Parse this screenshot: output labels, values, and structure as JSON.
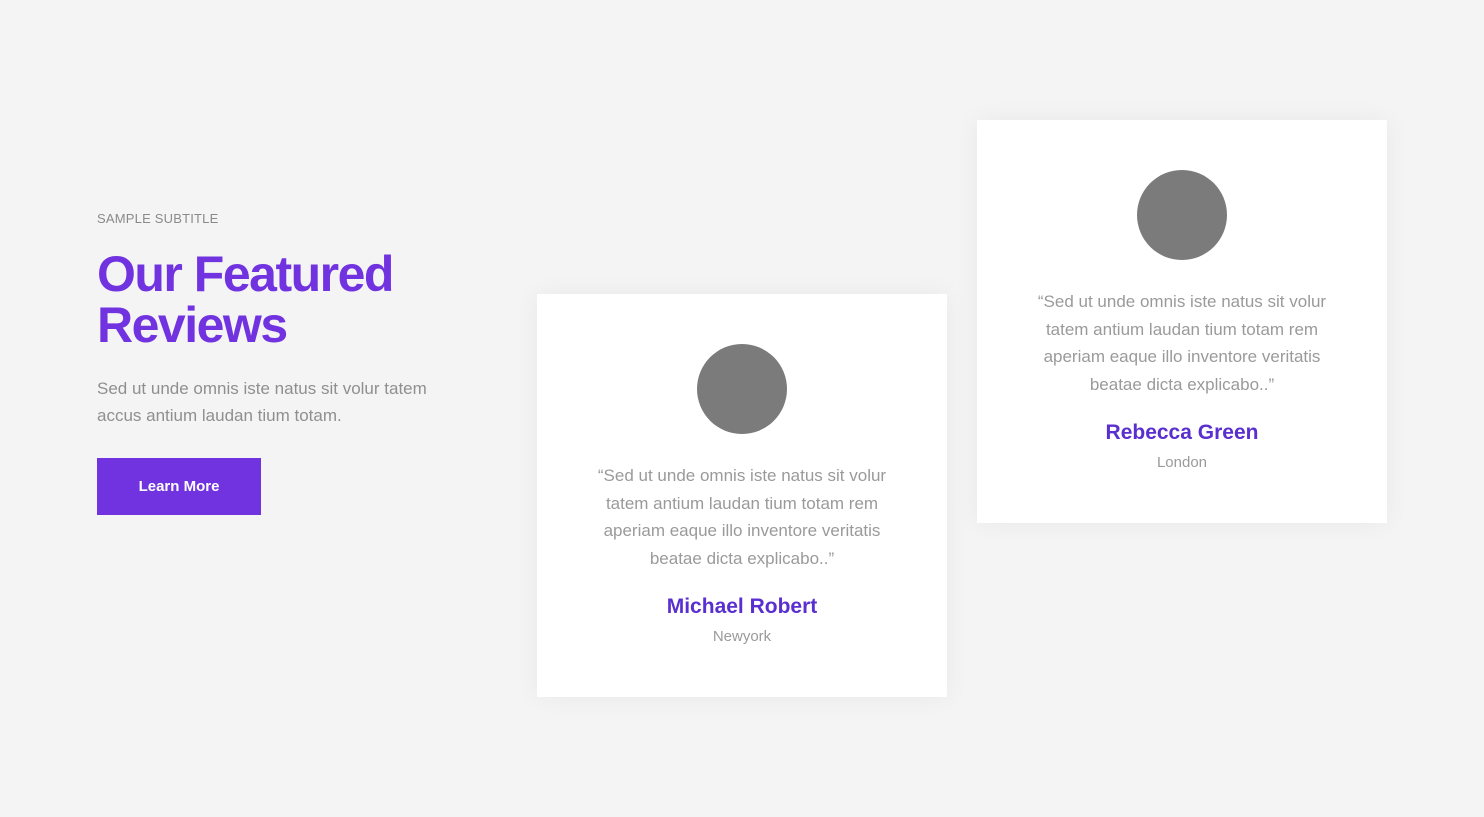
{
  "intro": {
    "subtitle": "SAMPLE SUBTITLE",
    "title_line1": "Our Featured",
    "title_line2": "Reviews",
    "description": "Sed ut unde omnis iste natus sit volur tatem accus antium laudan tium totam.",
    "button_label": "Learn More"
  },
  "reviews": [
    {
      "quote": "“Sed ut unde omnis iste natus sit volur tatem antium laudan tium totam rem aperiam eaque illo inventore veritatis beatae dicta explicabo..”",
      "name": "Michael Robert",
      "location": "Newyork"
    },
    {
      "quote": "“Sed ut unde omnis iste natus sit volur tatem antium laudan tium totam rem aperiam eaque illo inventore veritatis beatae dicta explicabo..”",
      "name": "Rebecca Green",
      "location": "London"
    }
  ],
  "colors": {
    "accent": "#7133e0",
    "background": "#f4f4f4",
    "avatar_placeholder": "#7b7b7c"
  }
}
